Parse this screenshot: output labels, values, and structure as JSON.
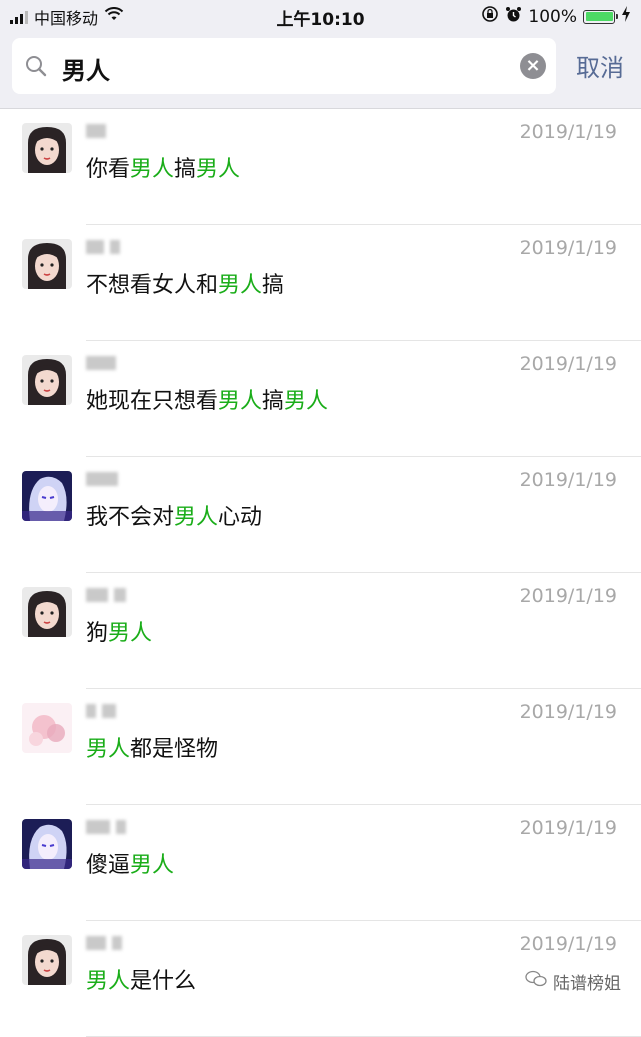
{
  "status_bar": {
    "carrier": "中国移动",
    "time": "上午10:10",
    "battery": "100%",
    "battery_level": 1.0
  },
  "search": {
    "query": "男人",
    "cancel_label": "取消"
  },
  "results": [
    {
      "date": "2019/1/19",
      "parts": [
        {
          "t": "你看"
        },
        {
          "t": "男人",
          "hl": true
        },
        {
          "t": "搞"
        },
        {
          "t": "男人",
          "hl": true
        }
      ],
      "avatar": "girl"
    },
    {
      "date": "2019/1/19",
      "parts": [
        {
          "t": "不想看女人和"
        },
        {
          "t": "男人",
          "hl": true
        },
        {
          "t": "搞"
        }
      ],
      "avatar": "girl"
    },
    {
      "date": "2019/1/19",
      "parts": [
        {
          "t": "她现在只想看"
        },
        {
          "t": "男人",
          "hl": true
        },
        {
          "t": "搞"
        },
        {
          "t": "男人",
          "hl": true
        }
      ],
      "avatar": "girl"
    },
    {
      "date": "2019/1/19",
      "parts": [
        {
          "t": "我不会对"
        },
        {
          "t": "男人",
          "hl": true
        },
        {
          "t": "心动"
        }
      ],
      "avatar": "anime"
    },
    {
      "date": "2019/1/19",
      "parts": [
        {
          "t": "狗"
        },
        {
          "t": "男人",
          "hl": true
        }
      ],
      "avatar": "girl"
    },
    {
      "date": "2019/1/19",
      "parts": [
        {
          "t": "男人",
          "hl": true
        },
        {
          "t": "都是怪物"
        }
      ],
      "avatar": "pink"
    },
    {
      "date": "2019/1/19",
      "parts": [
        {
          "t": "傻逼"
        },
        {
          "t": "男人",
          "hl": true
        }
      ],
      "avatar": "anime"
    },
    {
      "date": "2019/1/19",
      "parts": [
        {
          "t": "男人",
          "hl": true
        },
        {
          "t": "是什么"
        }
      ],
      "avatar": "girl"
    }
  ],
  "watermark": {
    "text": "陆谱榜姐"
  }
}
